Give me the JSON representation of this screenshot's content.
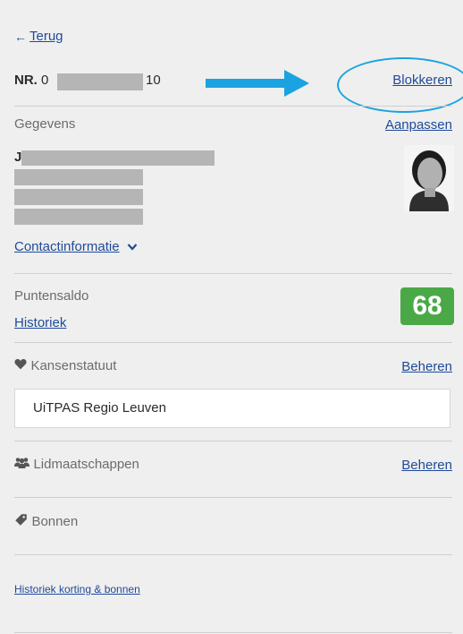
{
  "back": {
    "label": "Terug",
    "icon": "arrow-left-icon"
  },
  "card": {
    "nr_prefix": "NR.",
    "nr_start": "0",
    "nr_end": "10",
    "block_label": "Blokkeren"
  },
  "details": {
    "section_label": "Gegevens",
    "edit_label": "Aanpassen",
    "name_initial": "J",
    "contact_label": "Contactinformatie"
  },
  "points": {
    "label": "Puntensaldo",
    "history_label": "Historiek",
    "value": "68",
    "badge_color": "#4aa946"
  },
  "kansenstatuut": {
    "label": "Kansenstatuut",
    "manage_label": "Beheren",
    "icon": "heart-icon",
    "pass_name": "UiTPAS Regio Leuven"
  },
  "memberships": {
    "label": "Lidmaatschappen",
    "manage_label": "Beheren",
    "icon": "group-icon"
  },
  "vouchers": {
    "label": "Bonnen",
    "icon": "tag-icon"
  },
  "footer": {
    "history_link": "Historiek korting & bonnen"
  },
  "colors": {
    "link": "#1f4a9a",
    "annotation": "#1aa3e0",
    "background": "#efefef"
  }
}
